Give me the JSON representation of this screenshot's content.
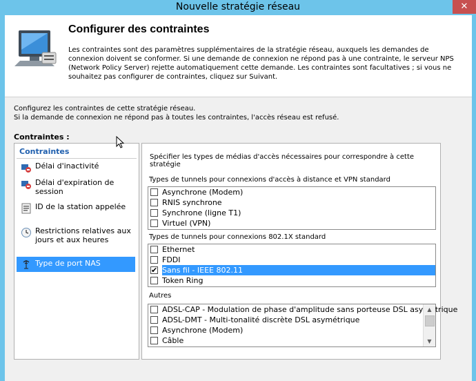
{
  "window": {
    "title": "Nouvelle stratégie réseau",
    "close_glyph": "✕"
  },
  "header": {
    "title": "Configurer des contraintes",
    "description": "Les contraintes sont des paramètres supplémentaires de la stratégie réseau, auxquels les demandes de connexion doivent se conformer. Si une demande de connexion ne répond pas à une contrainte, le serveur NPS (Network Policy Server) rejette automatiquement cette demande. Les contraintes sont facultatives ; si vous ne souhaitez pas configurer de contraintes, cliquez sur Suivant."
  },
  "intro": {
    "line1": "Configurez les contraintes de cette stratégie réseau.",
    "line2": "Si la demande de connexion ne répond pas à toutes les contraintes, l'accès réseau est refusé."
  },
  "constraints_label": "Contraintes :",
  "nav": {
    "heading": "Contraintes",
    "items": [
      {
        "label": "Délai d'inactivité",
        "icon": "idle-timeout-icon"
      },
      {
        "label": "Délai d'expiration de session",
        "icon": "session-timeout-icon"
      },
      {
        "label": "ID de la station appelée",
        "icon": "called-station-id-icon"
      },
      {
        "label": "Restrictions relatives aux jours et aux heures",
        "icon": "day-time-restrictions-icon"
      },
      {
        "label": "Type de port NAS",
        "icon": "nas-port-type-icon",
        "selected": true
      }
    ]
  },
  "content": {
    "description": "Spécifier les types de médias d'accès nécessaires pour correspondre à cette stratégie",
    "groups": [
      {
        "label": "Types de tunnels pour connexions d'accès à distance et VPN standard",
        "items": [
          {
            "label": "Asynchrone (Modem)",
            "checked": false
          },
          {
            "label": "RNIS synchrone",
            "checked": false
          },
          {
            "label": "Synchrone (ligne T1)",
            "checked": false
          },
          {
            "label": "Virtuel (VPN)",
            "checked": false
          }
        ]
      },
      {
        "label": "Types de tunnels pour connexions 802.1X standard",
        "items": [
          {
            "label": "Ethernet",
            "checked": false
          },
          {
            "label": "FDDI",
            "checked": false
          },
          {
            "label": "Sans fil - IEEE 802.11",
            "checked": true,
            "selected": true
          },
          {
            "label": "Token Ring",
            "checked": false
          }
        ]
      },
      {
        "label": "Autres",
        "items": [
          {
            "label": "ADSL-CAP - Modulation de phase d'amplitude sans porteuse DSL asymétrique",
            "checked": false
          },
          {
            "label": "ADSL-DMT - Multi-tonalité discrète DSL asymétrique",
            "checked": false
          },
          {
            "label": "Asynchrone (Modem)",
            "checked": false
          },
          {
            "label": "Câble",
            "checked": false
          }
        ]
      }
    ]
  },
  "colors": {
    "titlebar": "#6dc4ea",
    "selection": "#3399ff",
    "nav_heading": "#1f5fae",
    "close": "#c75050"
  }
}
